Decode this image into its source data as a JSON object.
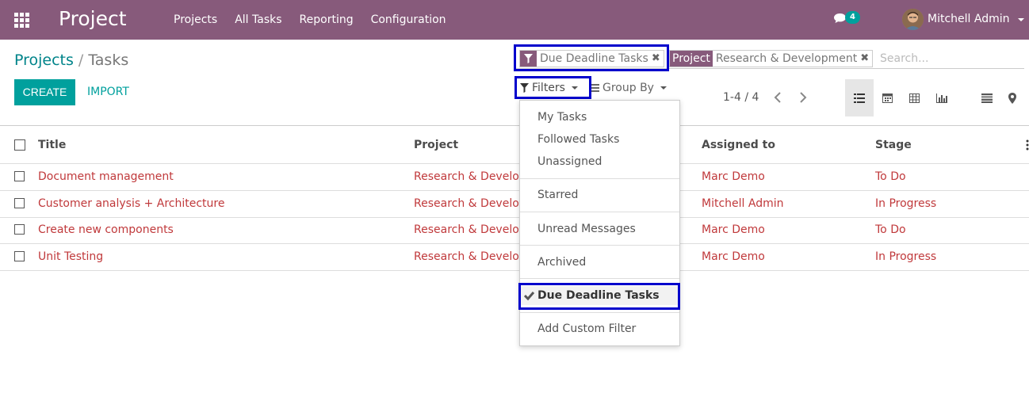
{
  "navbar": {
    "app_name": "Project",
    "menu": [
      "Projects",
      "All Tasks",
      "Reporting",
      "Configuration"
    ],
    "message_count": "4",
    "user_name": "Mitchell Admin"
  },
  "breadcrumb": {
    "parent": "Projects",
    "separator": "/",
    "current": "Tasks"
  },
  "buttons": {
    "create": "CREATE",
    "import": "IMPORT"
  },
  "search": {
    "facet_deadline": "Due Deadline Tasks",
    "facet_project_label": "Project",
    "facet_project_value": "Research & Development",
    "remove_glyph": "✖",
    "placeholder": "Search..."
  },
  "filters_label": "Filters",
  "groupby_label": "Group By",
  "pager": {
    "value": "1-4 / 4"
  },
  "views": [
    "list-icon",
    "calendar-icon",
    "pivot-icon",
    "graph-icon",
    "activity-icon",
    "map-icon"
  ],
  "columns": {
    "title": "Title",
    "project": "Project",
    "assigned": "Assigned to",
    "stage": "Stage"
  },
  "rows": [
    {
      "title": "Document management",
      "project": "Research & Development",
      "assigned": "Marc Demo",
      "stage": "To Do"
    },
    {
      "title": "Customer analysis + Architecture",
      "project": "Research & Development",
      "assigned": "Mitchell Admin",
      "stage": "In Progress"
    },
    {
      "title": "Create new components",
      "project": "Research & Development",
      "assigned": "Marc Demo",
      "stage": "To Do"
    },
    {
      "title": "Unit Testing",
      "project": "Research & Development",
      "assigned": "Marc Demo",
      "stage": "In Progress"
    }
  ],
  "filter_menu": {
    "my_tasks": "My Tasks",
    "followed": "Followed Tasks",
    "unassigned": "Unassigned",
    "starred": "Starred",
    "unread": "Unread Messages",
    "archived": "Archived",
    "due_deadline": "Due Deadline Tasks",
    "custom": "Add Custom Filter"
  },
  "colors": {
    "brand": "#875a7b",
    "accent": "#00a09d",
    "link_red": "#c0393b",
    "highlight": "#0000cc"
  }
}
